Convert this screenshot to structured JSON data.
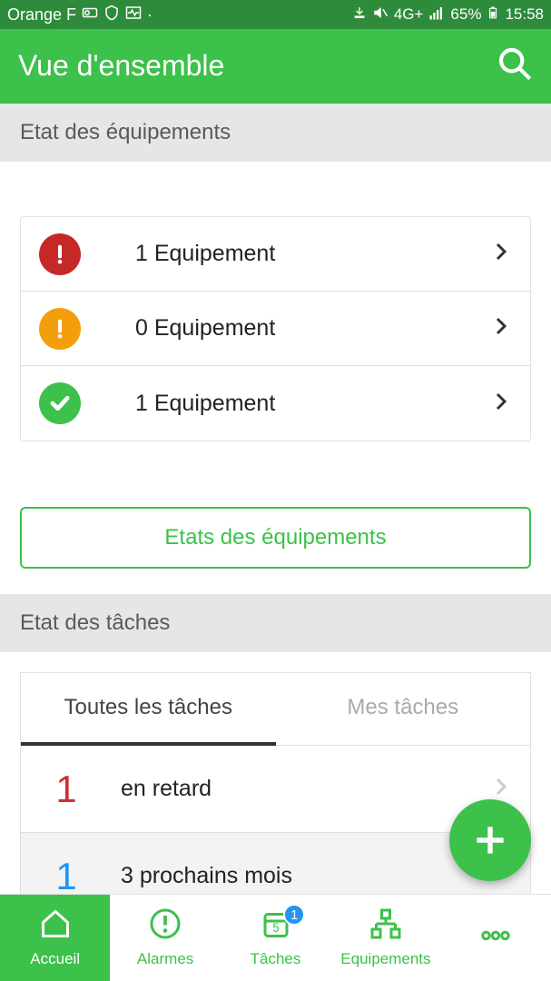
{
  "statusbar": {
    "carrier": "Orange F",
    "network": "4G+",
    "battery": "65%",
    "time": "15:58"
  },
  "appbar": {
    "title": "Vue d'ensemble"
  },
  "sections": {
    "equipment_header": "Etat des équipements",
    "tasks_header": "Etat des tâches"
  },
  "equipment": {
    "rows": [
      {
        "count_label": "1 Equipement",
        "status": "red"
      },
      {
        "count_label": "0 Equipement",
        "status": "orange"
      },
      {
        "count_label": "1 Equipement",
        "status": "green"
      }
    ],
    "button_label": "Etats des équipements"
  },
  "tasks": {
    "tabs": {
      "all": "Toutes les tâches",
      "mine": "Mes tâches"
    },
    "rows": [
      {
        "count": "1",
        "label": "en retard",
        "color": "red"
      },
      {
        "count": "1",
        "label": "3 prochains mois",
        "color": "blue"
      }
    ]
  },
  "bottomnav": {
    "home": "Accueil",
    "alarms": "Alarmes",
    "tasks": "Tâches",
    "equipment": "Equipements",
    "badge": "1"
  }
}
